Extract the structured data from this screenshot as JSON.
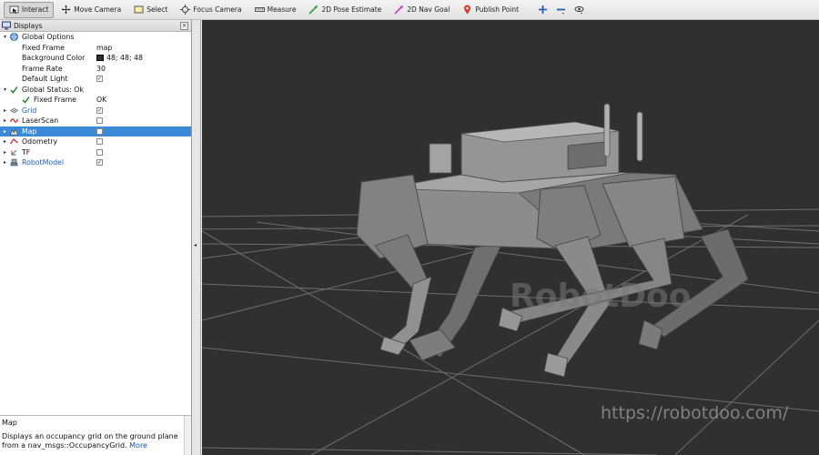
{
  "toolbar": {
    "tools": [
      {
        "label": "Interact",
        "icon": "interact-icon",
        "active": true
      },
      {
        "label": "Move Camera",
        "icon": "move-camera-icon"
      },
      {
        "label": "Select",
        "icon": "select-icon"
      },
      {
        "label": "Focus Camera",
        "icon": "focus-camera-icon"
      },
      {
        "label": "Measure",
        "icon": "measure-icon"
      },
      {
        "label": "2D Pose Estimate",
        "icon": "pose-estimate-icon"
      },
      {
        "label": "2D Nav Goal",
        "icon": "nav-goal-icon"
      },
      {
        "label": "Publish Point",
        "icon": "publish-point-icon"
      }
    ]
  },
  "displays": {
    "title": "Displays",
    "close": "×",
    "tree": [
      {
        "label": "Global Options",
        "level": 0,
        "arrow": "▾",
        "icon": "globe-icon"
      },
      {
        "label": "Fixed Frame",
        "level": 1,
        "value": "map"
      },
      {
        "label": "Background Color",
        "level": 1,
        "value": "48; 48; 48",
        "swatch": "#303030"
      },
      {
        "label": "Frame Rate",
        "level": 1,
        "value": "30"
      },
      {
        "label": "Default Light",
        "level": 1,
        "check": true
      },
      {
        "label": "Global Status: Ok",
        "level": 0,
        "arrow": "▾",
        "icon": "check-icon"
      },
      {
        "label": "Fixed Frame",
        "level": 1,
        "icon": "check-icon",
        "value": "OK"
      },
      {
        "label": "Grid",
        "level": 0,
        "arrow": "▸",
        "icon": "grid-icon",
        "blue": true,
        "check": true
      },
      {
        "label": "LaserScan",
        "level": 0,
        "arrow": "▸",
        "icon": "laserscan-icon",
        "check": false
      },
      {
        "label": "Map",
        "level": 0,
        "arrow": "▸",
        "icon": "map-icon",
        "selected": true,
        "check": false
      },
      {
        "label": "Odometry",
        "level": 0,
        "arrow": "▸",
        "icon": "odometry-icon",
        "check": false
      },
      {
        "label": "TF",
        "level": 0,
        "arrow": "▸",
        "icon": "tf-icon",
        "check": false
      },
      {
        "label": "RobotModel",
        "level": 0,
        "arrow": "▸",
        "icon": "robot-model-icon",
        "blue": true,
        "check": true
      }
    ]
  },
  "description": {
    "title": "Map",
    "text": "Displays an occupancy grid on the ground plane from a nav_msgs::OccupancyGrid.",
    "more": "More"
  },
  "viewport": {
    "background": "#303030",
    "watermark": "RobotDoo",
    "url": "https://robotdoo.com/"
  }
}
